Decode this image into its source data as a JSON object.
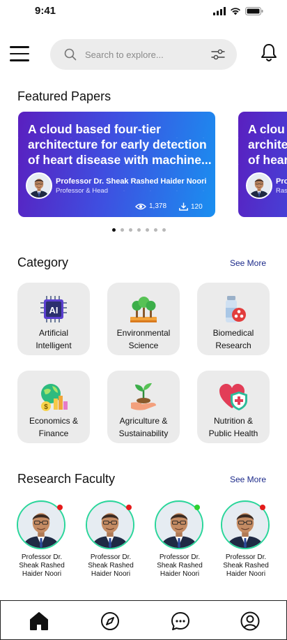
{
  "status_bar": {
    "time": "9:41"
  },
  "search": {
    "placeholder": "Search to explore..."
  },
  "featured": {
    "title": "Featured Papers",
    "cards": [
      {
        "title_lines": [
          "A cloud based four-tier",
          "architecture for early detection",
          "of heart disease with machine..."
        ],
        "author": "Professor Dr. Sheak Rashed Haider Noori",
        "role": "Professor & Head",
        "views": "1,378",
        "downloads": "120"
      },
      {
        "title_lines": [
          "A clou",
          "archite",
          "of hear"
        ],
        "author": "Prof",
        "role": "Ras"
      }
    ],
    "pagination": {
      "count": 7,
      "active": 0
    }
  },
  "category": {
    "title": "Category",
    "see_more": "See More",
    "items": [
      {
        "line1": "Artificial",
        "line2": "Intelligent",
        "icon": "ai-chip-icon"
      },
      {
        "line1": "Environmental",
        "line2": "Science",
        "icon": "trees-icon"
      },
      {
        "line1": "Biomedical",
        "line2": "Research",
        "icon": "biomedical-bottle-icon"
      },
      {
        "line1": "Economics &",
        "line2": "Finance",
        "icon": "globe-money-icon"
      },
      {
        "line1": "Agriculture &",
        "line2": "Sustainability",
        "icon": "plant-hand-icon"
      },
      {
        "line1": "Nutrition &",
        "line2": "Public Health",
        "icon": "heart-shield-icon"
      }
    ]
  },
  "faculty": {
    "title": "Research Faculty",
    "see_more": "See More",
    "members": [
      {
        "line1": "Professor Dr.",
        "line2": "Sheak Rashed",
        "line3": "Haider Noori",
        "status_color": "#e51b1b"
      },
      {
        "line1": "Professor Dr.",
        "line2": "Sheak Rashed",
        "line3": "Haider Noori",
        "status_color": "#e51b1b"
      },
      {
        "line1": "Professor Dr.",
        "line2": "Sheak Rashed",
        "line3": "Haider Noori",
        "status_color": "#2fd12f"
      },
      {
        "line1": "Professor Dr.",
        "line2": "Sheak Rashed",
        "line3": "Haider Noori",
        "status_color": "#e51b1b"
      }
    ]
  },
  "bottom_nav": {
    "items": [
      "home-icon",
      "compass-icon",
      "chat-icon",
      "profile-icon"
    ],
    "active": "home-icon"
  },
  "colors": {
    "accent": "#1c2a8a",
    "card_gradient_start": "#5a1fbf",
    "card_gradient_end": "#1a8ff0",
    "ring": "#2ad69a",
    "tile": "#ebebeb"
  }
}
